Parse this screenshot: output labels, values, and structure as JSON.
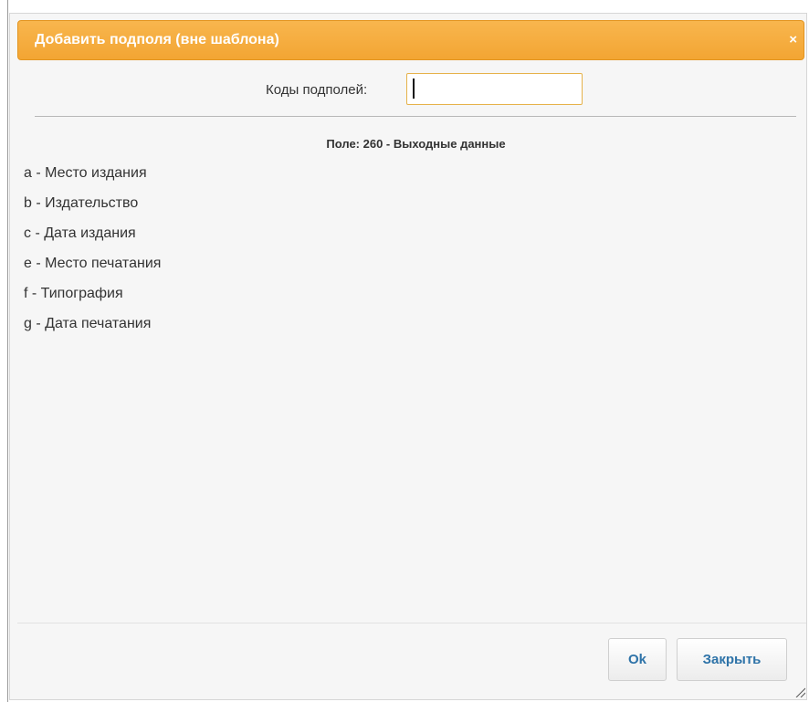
{
  "dialog": {
    "title": "Добавить подполя (вне шаблона)",
    "close_glyph": "×",
    "accent_color": "#f3a533"
  },
  "codes": {
    "label": "Коды подполей:",
    "value": "",
    "placeholder": ""
  },
  "field": {
    "title": "Поле: 260 - Выходные данные",
    "subfields": [
      "a - Место издания",
      "b - Издательство",
      "c - Дата издания",
      "e - Место печатания",
      "f - Типография",
      "g - Дата печатания"
    ]
  },
  "buttons": {
    "ok": "Ok",
    "close": "Закрыть"
  },
  "icons": {
    "close": "close-icon",
    "resize": "resize-handle-icon"
  }
}
